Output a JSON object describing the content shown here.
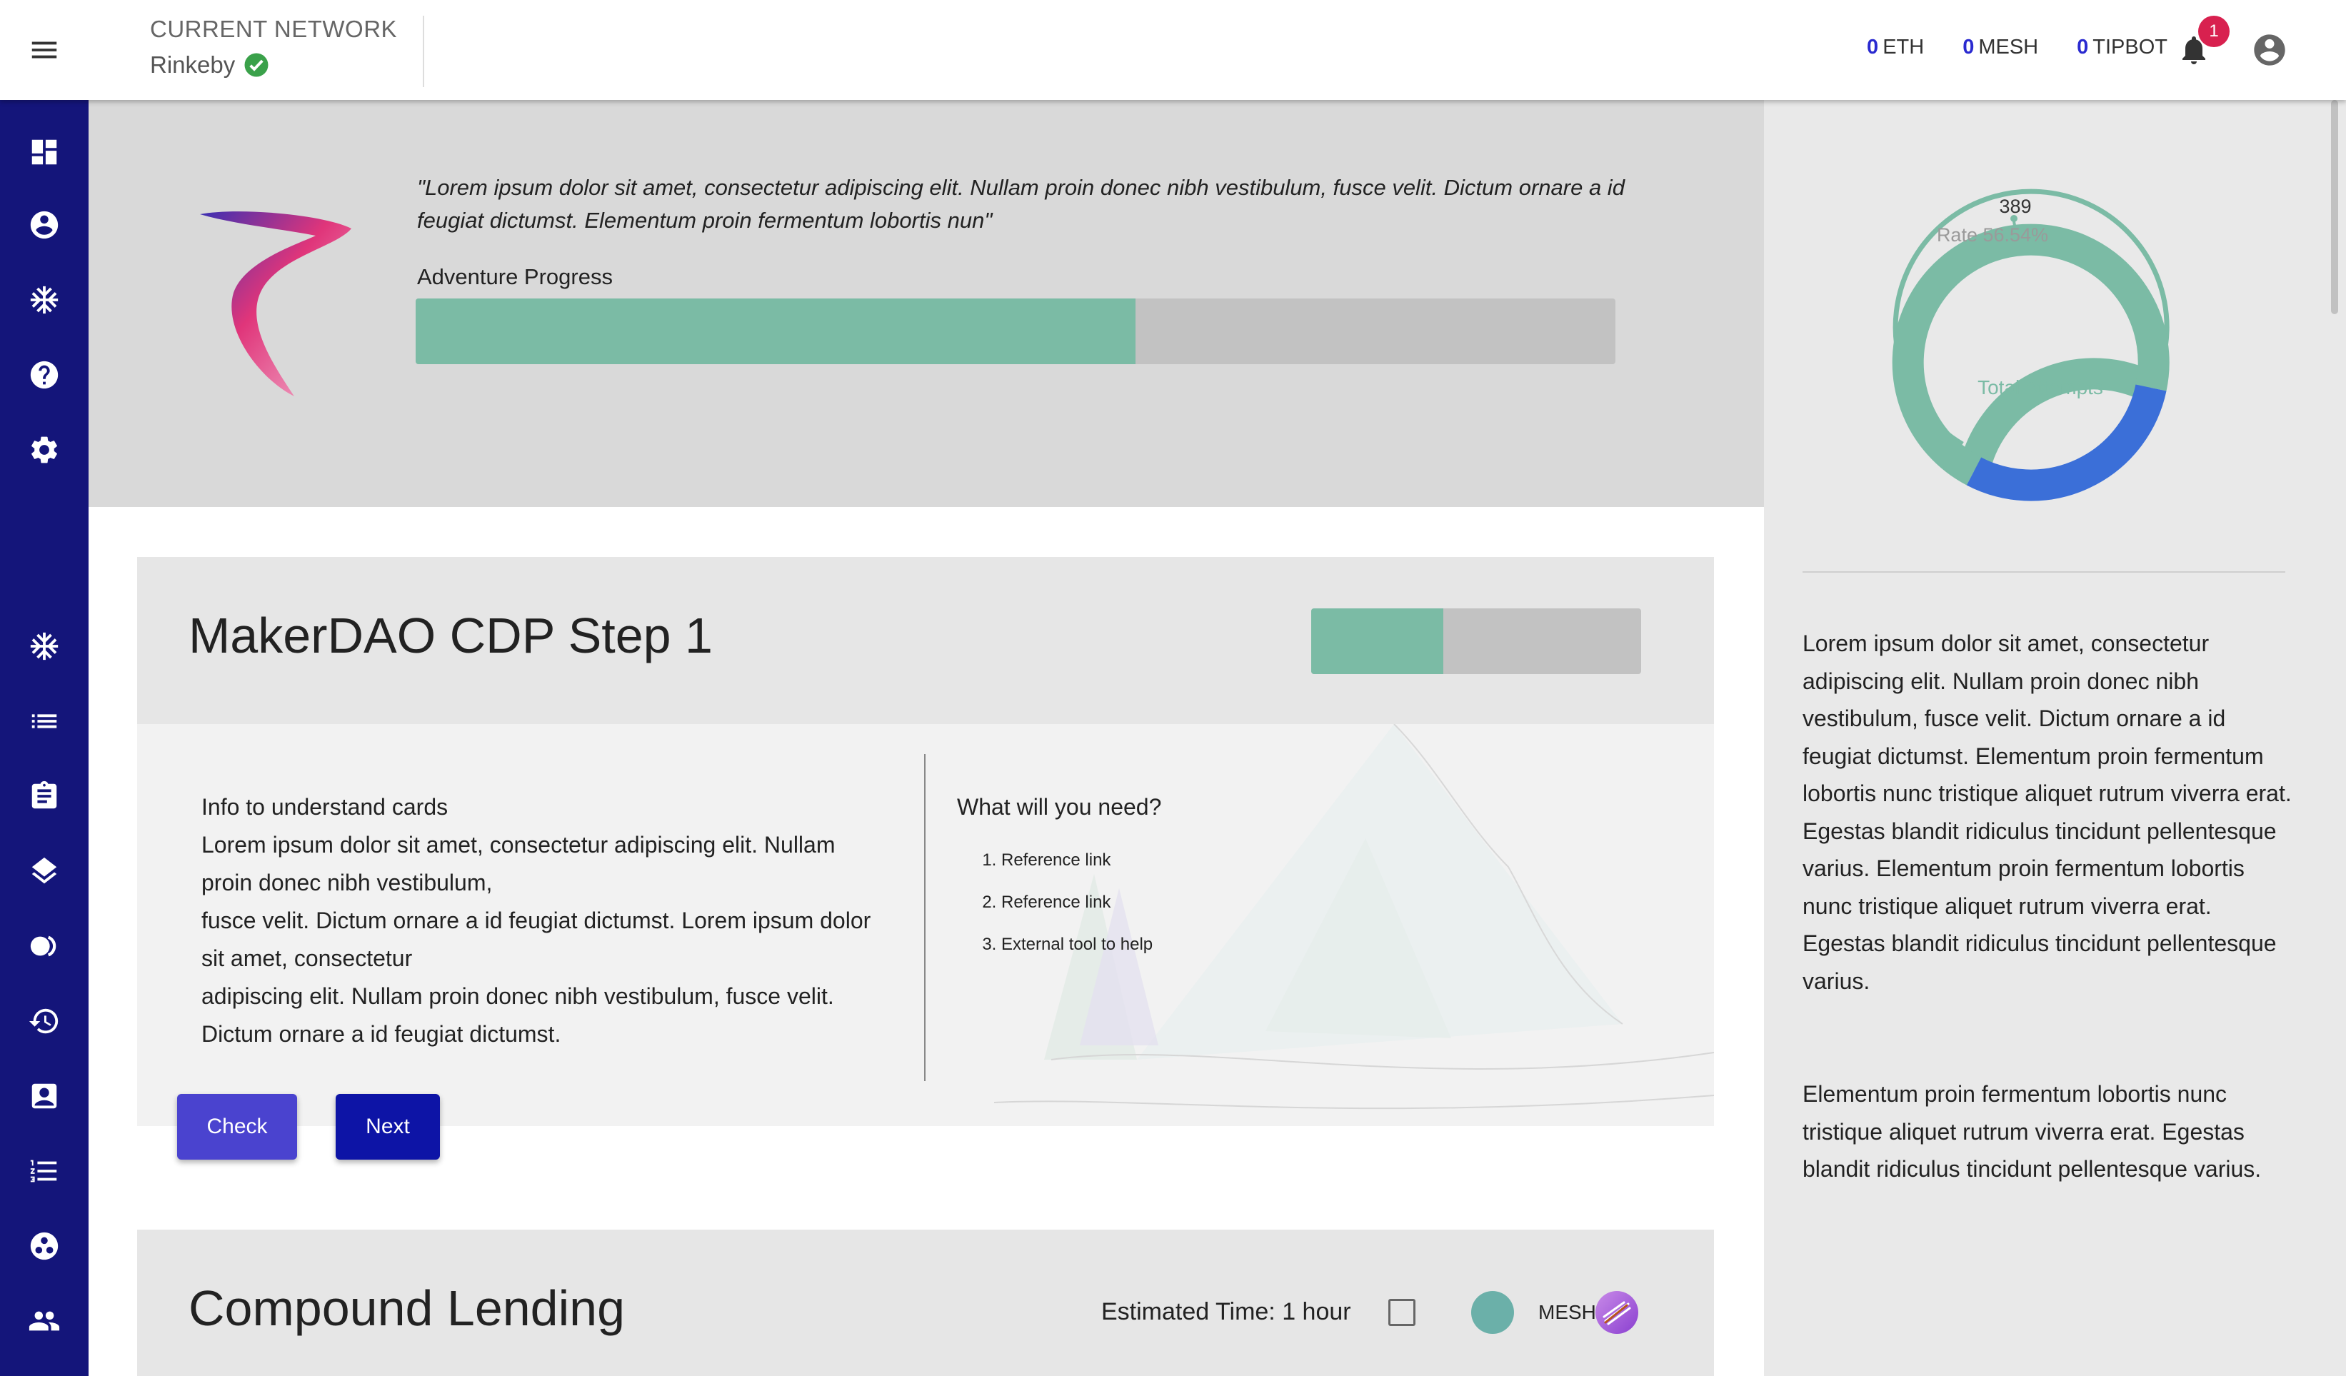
{
  "header": {
    "network_label": "CURRENT NETWORK",
    "network_value": "Rinkeby",
    "balances": [
      {
        "amount": "0",
        "unit": "ETH"
      },
      {
        "amount": "0",
        "unit": "MESH"
      },
      {
        "amount": "0",
        "unit": "TIPBOT"
      }
    ],
    "notification_count": "1"
  },
  "sidebar": {
    "icons": [
      "dashboard-icon",
      "account-circle-icon",
      "snowflake-icon",
      "help-icon",
      "settings-icon",
      "snowflake-icon",
      "list-icon",
      "clipboard-icon",
      "layers-icon",
      "toggle-icon",
      "history-icon",
      "contact-icon",
      "checklist-icon",
      "group-work-icon",
      "people-icon"
    ]
  },
  "hero": {
    "quote": "\"Lorem ipsum dolor sit amet, consectetur adipiscing elit. Nullam proin donec nibh vestibulum, fusce velit. Dictum ornare a id feugiat dictumst. Elementum proin fermentum lobortis nun\"",
    "progress_label": "Adventure Progress",
    "progress_value": 0.6
  },
  "stats": {
    "count": "389",
    "rate": "Rate 56.54%",
    "center_label": "Total Attempts",
    "rate_fraction": 0.5654,
    "colors": {
      "success": "#7bbba5",
      "fail": "#3b6fd8"
    }
  },
  "right_panel": {
    "paragraph1": "Lorem ipsum dolor sit amet, consectetur adipiscing elit. Nullam proin donec nibh vestibulum, fusce velit. Dictum ornare a id feugiat dictumst. Elementum proin fermentum lobortis nunc tristique aliquet rutrum viverra erat. Egestas blandit ridiculus tincidunt pellentesque varius. Elementum proin fermentum lobortis nunc tristique aliquet rutrum viverra erat. Egestas blandit ridiculus tincidunt pellentesque varius.",
    "paragraph2": "Elementum proin fermentum lobortis nunc tristique aliquet rutrum viverra erat. Egestas blandit ridiculus tincidunt pellentesque varius."
  },
  "card1": {
    "title": "MakerDAO CDP Step 1",
    "progress_value": 0.4,
    "info_title": "Info to understand cards",
    "info_lines": [
      "Lorem ipsum dolor sit amet, consectetur adipiscing elit. Nullam proin donec nibh vestibulum,",
      "fusce velit. Dictum ornare a id feugiat dictumst. Lorem ipsum dolor sit amet, consectetur",
      "adipiscing elit. Nullam proin donec nibh vestibulum, fusce velit. Dictum ornare a id feugiat dictumst."
    ],
    "need_title": "What will you need?",
    "need_items": [
      "Reference link",
      "Reference link",
      "External tool to help"
    ],
    "check_label": "Check",
    "next_label": "Next"
  },
  "card2": {
    "title": "Compound Lending",
    "estimated_time": "Estimated Time: 1 hour",
    "token_label": "MESH"
  }
}
